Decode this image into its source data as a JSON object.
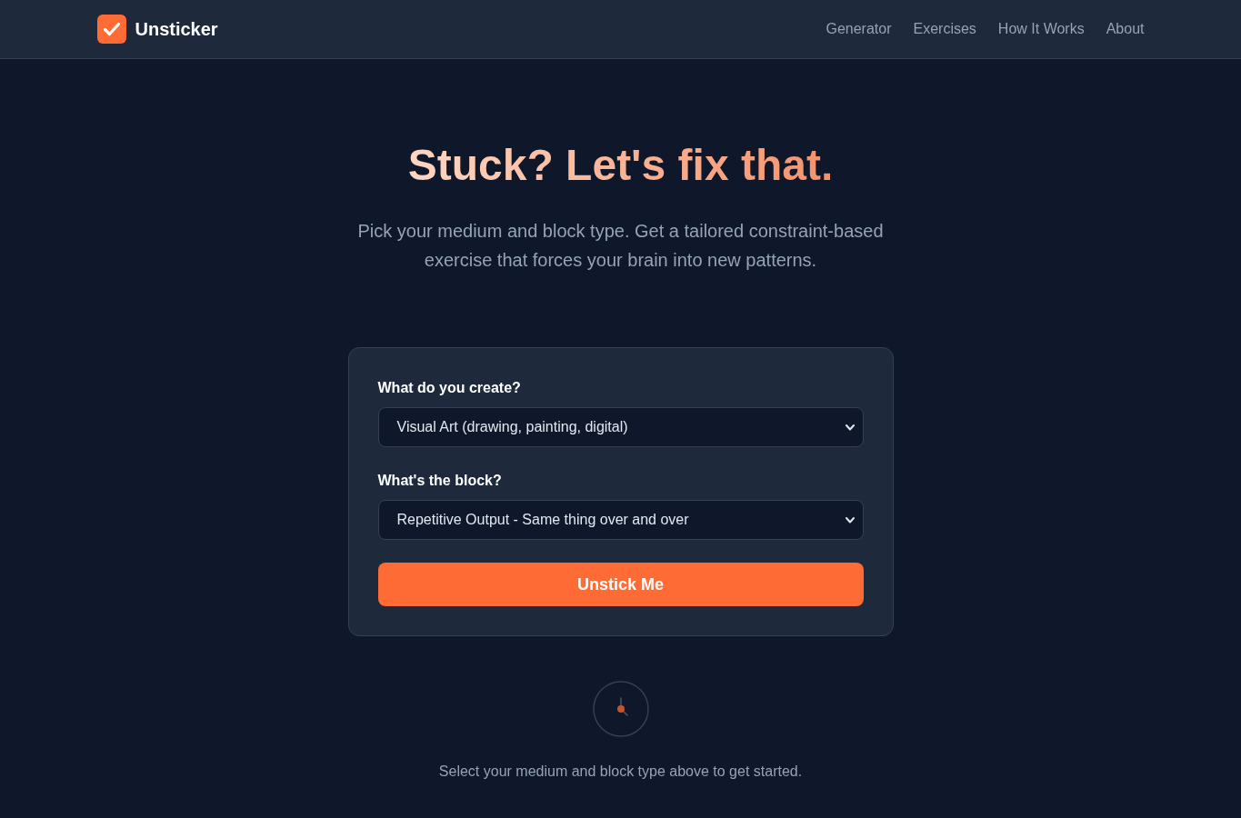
{
  "header": {
    "logo_text": "Unsticker",
    "nav": [
      "Generator",
      "Exercises",
      "How It Works",
      "About"
    ]
  },
  "hero": {
    "title": "Stuck? Let's fix that.",
    "subtitle": "Pick your medium and block type. Get a tailored constraint-based exercise that forces your brain into new patterns."
  },
  "form": {
    "fields": [
      {
        "label": "What do you create?",
        "value": "Visual Art (drawing, painting, digital)"
      },
      {
        "label": "What's the block?",
        "value": "Repetitive Output - Same thing over and over"
      }
    ],
    "submit": "Unstick Me"
  },
  "empty_state": {
    "message": "Select your medium and block type above to get started."
  }
}
